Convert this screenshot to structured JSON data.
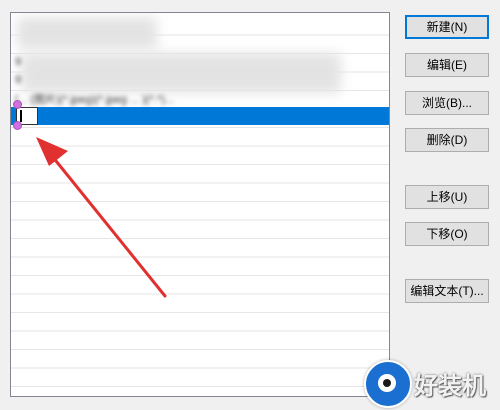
{
  "list": {
    "rows": [
      {
        "text": "",
        "state": "obscured"
      },
      {
        "text": "9",
        "state": "obscured"
      },
      {
        "text": "9",
        "state": "obscured"
      },
      {
        "text": "[... (图片)(*.jpeg)(*.jpeg ... )(*.*)...",
        "state": "obscured"
      },
      {
        "text": "",
        "state": "editing"
      }
    ]
  },
  "buttons": {
    "new": "新建(N)",
    "edit": "编辑(E)",
    "browse": "浏览(B)...",
    "delete": "删除(D)",
    "move_up": "上移(U)",
    "move_down": "下移(O)",
    "edit_text": "编辑文本(T)..."
  },
  "watermark": {
    "text": "好装机"
  },
  "colors": {
    "selection": "#0078d7",
    "arrow": "#e03030",
    "handle": "#d070e0",
    "watermark_logo": "#1a6fd1"
  }
}
